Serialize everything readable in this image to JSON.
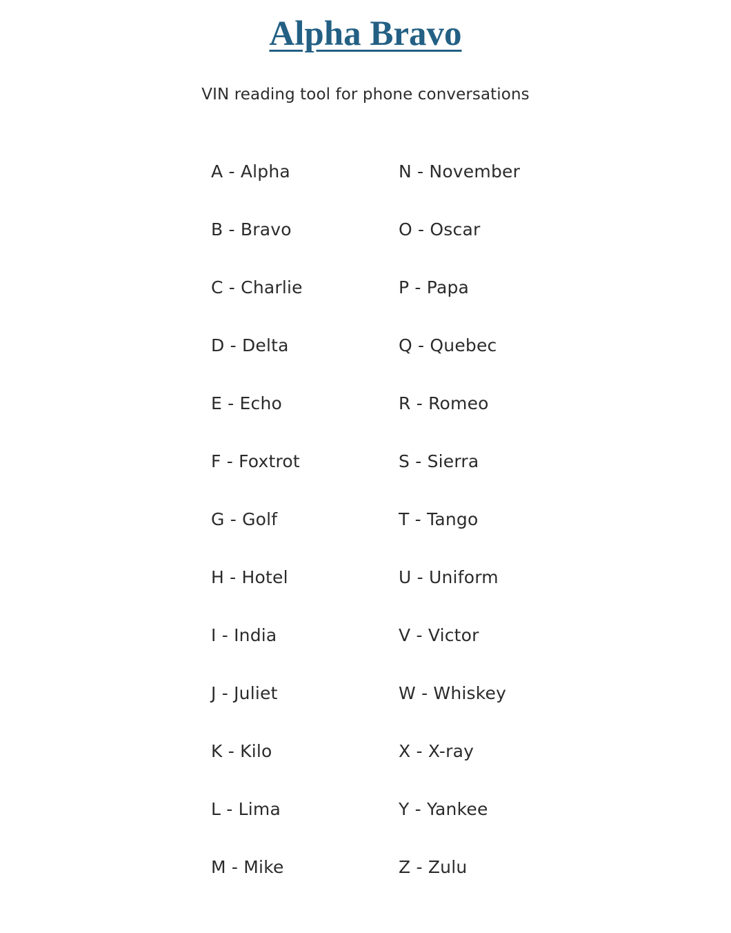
{
  "header": {
    "title": "Alpha Bravo",
    "subtitle": "VIN reading tool for phone conversations",
    "title_color": "#236084",
    "text_color": "#2b2b2b",
    "background_color": "#ffffff"
  },
  "phonetic_table": {
    "left_column": [
      {
        "letter": "A",
        "word": "Alpha",
        "text": "A - Alpha"
      },
      {
        "letter": "B",
        "word": "Bravo",
        "text": "B - Bravo"
      },
      {
        "letter": "C",
        "word": "Charlie",
        "text": "C - Charlie"
      },
      {
        "letter": "D",
        "word": "Delta",
        "text": "D - Delta"
      },
      {
        "letter": "E",
        "word": "Echo",
        "text": "E - Echo"
      },
      {
        "letter": "F",
        "word": "Foxtrot",
        "text": "F - Foxtrot"
      },
      {
        "letter": "G",
        "word": "Golf",
        "text": "G - Golf"
      },
      {
        "letter": "H",
        "word": "Hotel",
        "text": "H - Hotel"
      },
      {
        "letter": "I",
        "word": "India",
        "text": "I - India"
      },
      {
        "letter": "J",
        "word": "Juliet",
        "text": "J - Juliet"
      },
      {
        "letter": "K",
        "word": "Kilo",
        "text": "K - Kilo"
      },
      {
        "letter": "L",
        "word": "Lima",
        "text": "L - Lima"
      },
      {
        "letter": "M",
        "word": "Mike",
        "text": "M - Mike"
      }
    ],
    "right_column": [
      {
        "letter": "N",
        "word": "November",
        "text": "N - November"
      },
      {
        "letter": "O",
        "word": "Oscar",
        "text": "O - Oscar"
      },
      {
        "letter": "P",
        "word": "Papa",
        "text": "P - Papa"
      },
      {
        "letter": "Q",
        "word": "Quebec",
        "text": "Q - Quebec"
      },
      {
        "letter": "R",
        "word": "Romeo",
        "text": "R - Romeo"
      },
      {
        "letter": "S",
        "word": "Sierra",
        "text": "S - Sierra"
      },
      {
        "letter": "T",
        "word": "Tango",
        "text": "T - Tango"
      },
      {
        "letter": "U",
        "word": "Uniform",
        "text": "U - Uniform"
      },
      {
        "letter": "V",
        "word": "Victor",
        "text": "V - Victor"
      },
      {
        "letter": "W",
        "word": "Whiskey",
        "text": "W - Whiskey"
      },
      {
        "letter": "X",
        "word": "X-ray",
        "text": "X - X-ray"
      },
      {
        "letter": "Y",
        "word": "Yankee",
        "text": "Y - Yankee"
      },
      {
        "letter": "Z",
        "word": "Zulu",
        "text": "Z - Zulu"
      }
    ]
  }
}
